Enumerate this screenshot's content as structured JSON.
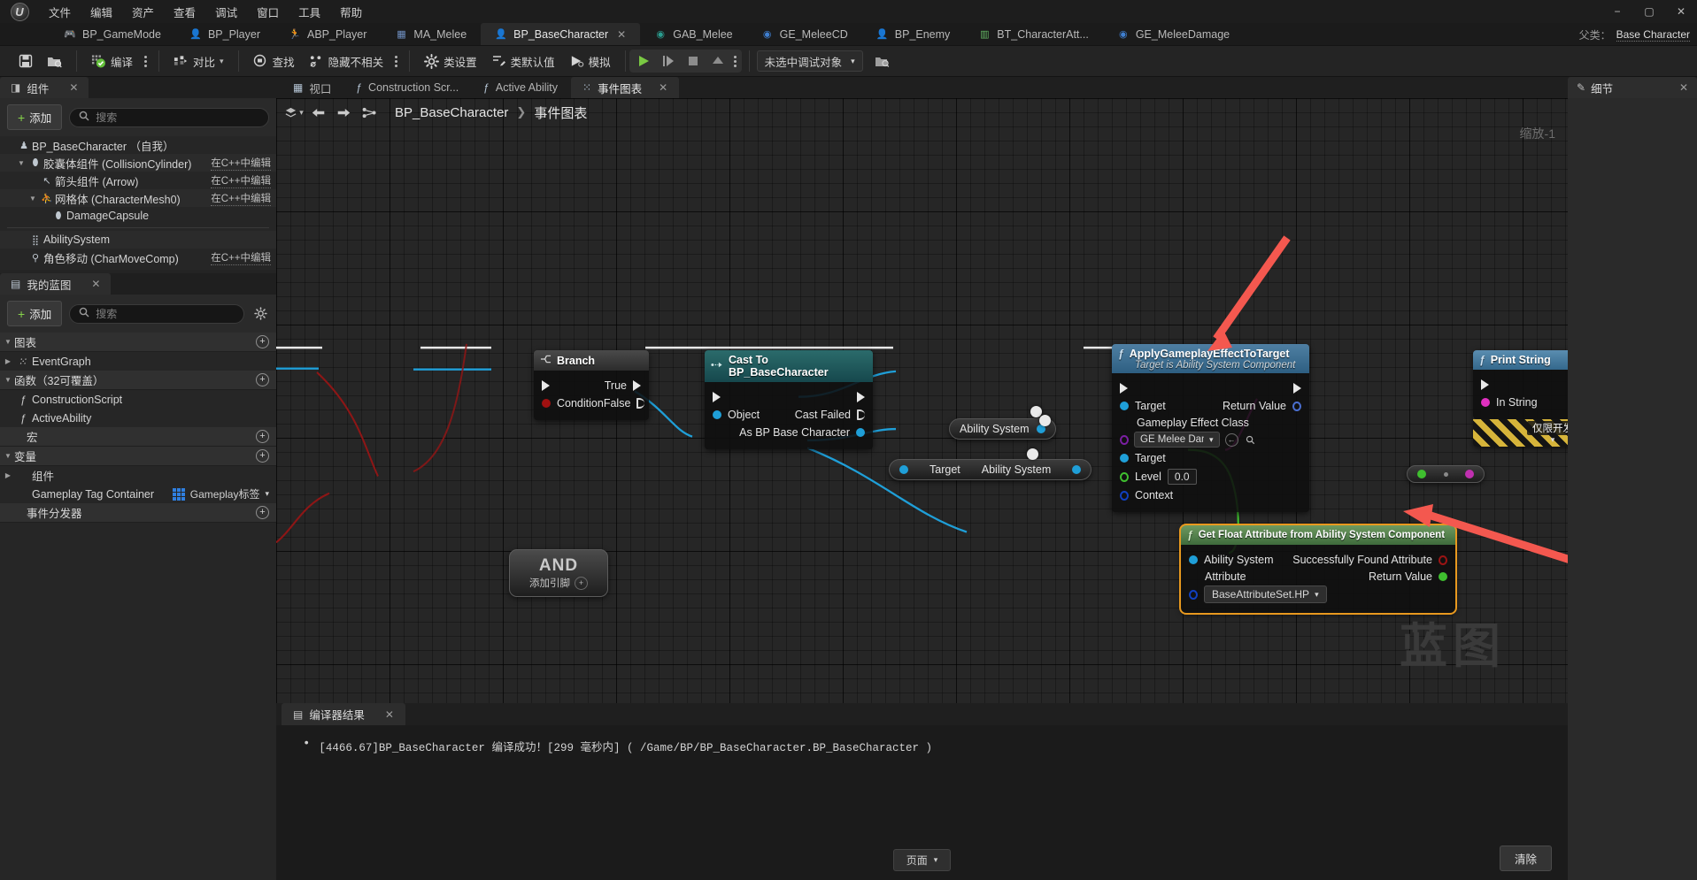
{
  "app": {
    "logo_glyph": "U",
    "menu": [
      "文件",
      "编辑",
      "资产",
      "查看",
      "调试",
      "窗口",
      "工具",
      "帮助"
    ],
    "window_controls": {
      "minimize": "−",
      "maximize": "▢",
      "close": "✕"
    }
  },
  "asset_tabs": [
    {
      "label": "BP_GameMode",
      "icon": "gamemode-icon",
      "glyph": "🎮",
      "color": "#3f7fd0",
      "active": false
    },
    {
      "label": "BP_Player",
      "icon": "character-icon",
      "glyph": "👤",
      "color": "#3f7fd0",
      "active": false
    },
    {
      "label": "ABP_Player",
      "icon": "animbp-icon",
      "glyph": "🏃",
      "color": "#c08a2a",
      "active": false
    },
    {
      "label": "MA_Melee",
      "icon": "montage-icon",
      "glyph": "▦",
      "color": "#6f8fc0",
      "active": false
    },
    {
      "label": "BP_BaseCharacter",
      "icon": "character-icon",
      "glyph": "👤",
      "color": "#3f7fd0",
      "active": true,
      "close": "✕"
    },
    {
      "label": "GAB_Melee",
      "icon": "ability-icon",
      "glyph": "◉",
      "color": "#2a9d8f",
      "active": false
    },
    {
      "label": "GE_MeleeCD",
      "icon": "effect-icon",
      "glyph": "◉",
      "color": "#3f7fd0",
      "active": false
    },
    {
      "label": "BP_Enemy",
      "icon": "character-icon",
      "glyph": "👤",
      "color": "#3f7fd0",
      "active": false
    },
    {
      "label": "BT_CharacterAtt...",
      "icon": "behaviortree-icon",
      "glyph": "▥",
      "color": "#63b463",
      "active": false
    },
    {
      "label": "GE_MeleeDamage",
      "icon": "effect-icon",
      "glyph": "◉",
      "color": "#3f7fd0",
      "active": false
    }
  ],
  "parent_class": {
    "label": "父类：",
    "value": "Base Character"
  },
  "toolbar": {
    "save_icon": "save-icon",
    "browse_icon": "browse-content-icon",
    "compile_label": "编译",
    "compile_icon": "compile-check-icon",
    "diff_label": "对比",
    "diff_icon": "diff-icon",
    "find_label": "查找",
    "find_icon": "find-icon",
    "hide_unrelated_label": "隐藏不相关",
    "hide_unrelated_icon": "hide-unrelated-icon",
    "class_settings_label": "类设置",
    "class_settings_icon": "gear-icon",
    "class_defaults_label": "类默认值",
    "class_defaults_icon": "defaults-icon",
    "simulate_label": "模拟",
    "simulate_icon": "simulate-icon",
    "play_icon": "play-icon",
    "step_icon": "step-icon",
    "stop_icon": "stop-icon",
    "eject_icon": "eject-icon",
    "debug_object": "未选中调试对象",
    "debug_dropdown_icon": "chevron-down-icon"
  },
  "components_panel": {
    "tab_label": "组件",
    "tab_icon": "components-icon",
    "close_icon": "✕",
    "add_label": "添加",
    "search_placeholder": "搜索",
    "search_icon": "search-icon",
    "tree": [
      {
        "indent": 0,
        "arrow": "",
        "icon": "character-icon",
        "label": "BP_BaseCharacter （自我）",
        "cpp": ""
      },
      {
        "indent": 1,
        "arrow": "▼",
        "icon": "capsule-icon",
        "label": "胶囊体组件 (CollisionCylinder)",
        "cpp": "在C++中编辑"
      },
      {
        "indent": 2,
        "arrow": "",
        "icon": "arrow-icon",
        "label": "箭头组件 (Arrow)",
        "cpp": "在C++中编辑"
      },
      {
        "indent": 2,
        "arrow": "▼",
        "icon": "mesh-icon",
        "label": "网格体 (CharacterMesh0)",
        "cpp": "在C++中编辑"
      },
      {
        "indent": 3,
        "arrow": "",
        "icon": "capsule-icon",
        "label": "DamageCapsule",
        "cpp": ""
      },
      {
        "indent": 1,
        "arrow": "",
        "icon": "abilitysystem-icon",
        "label": "AbilitySystem",
        "cpp": "",
        "divider_before": true
      },
      {
        "indent": 1,
        "arrow": "",
        "icon": "movement-icon",
        "label": "角色移动 (CharMoveComp)",
        "cpp": "在C++中编辑"
      }
    ]
  },
  "myblueprint_panel": {
    "tab_label": "我的蓝图",
    "tab_icon": "blueprint-icon",
    "close_icon": "✕",
    "add_label": "添加",
    "search_placeholder": "搜索",
    "search_icon": "search-icon",
    "settings_icon": "gear-icon",
    "sections": [
      {
        "label": "图表",
        "arrow": "▼",
        "plus": "+",
        "items": [
          {
            "icon": "graph-icon",
            "label": "EventGraph",
            "arrow": "▶"
          }
        ]
      },
      {
        "label": "函数（32可覆盖）",
        "arrow": "▼",
        "plus": "+",
        "items": [
          {
            "icon": "function-override-icon",
            "label": "ConstructionScript",
            "arrow": ""
          },
          {
            "icon": "function-icon",
            "label": "ActiveAbility",
            "arrow": ""
          }
        ]
      },
      {
        "label": "宏",
        "arrow": "",
        "plus": "+",
        "items": []
      },
      {
        "label": "变量",
        "arrow": "▼",
        "plus": "+",
        "items": [
          {
            "icon": "",
            "label": "组件",
            "arrow": "▶"
          },
          {
            "icon": "",
            "label": "Gameplay Tag Container",
            "arrow": "",
            "var_type": "Gameplay标签",
            "var_type_icon": "gameplay-tag-icon"
          }
        ]
      },
      {
        "label": "事件分发器",
        "arrow": "",
        "plus": "+",
        "items": []
      }
    ]
  },
  "graph_tabs": [
    {
      "label": "视口",
      "icon": "viewport-icon",
      "active": false
    },
    {
      "label": "Construction Scr...",
      "icon": "function-icon",
      "active": false
    },
    {
      "label": "Active Ability",
      "icon": "function-icon",
      "active": false
    },
    {
      "label": "事件图表",
      "icon": "graph-icon",
      "active": true,
      "close": "✕"
    }
  ],
  "graph": {
    "back_icon": "back-arrow-icon",
    "forward_icon": "forward-arrow-icon",
    "home_icon": "graph-home-icon",
    "layers_icon": "layers-icon",
    "breadcrumb_root": "BP_BaseCharacter",
    "breadcrumb_sep": "❯",
    "breadcrumb_leaf": "事件图表",
    "zoom_label": "缩放-1",
    "watermark": "蓝图"
  },
  "nodes": {
    "branch": {
      "title": "Branch",
      "icon": "branch-icon",
      "exec_in": "",
      "rows": [
        {
          "left_label": "",
          "left_pin": "exec",
          "right_label": "True",
          "right_pin": "exec"
        },
        {
          "left_label": "Condition",
          "left_pin": "bool",
          "right_label": "False",
          "right_pin": "exec-hollow"
        }
      ]
    },
    "cast": {
      "title": "Cast To BP_BaseCharacter",
      "icon": "cast-icon",
      "rows": [
        {
          "left_label": "",
          "left_pin": "exec",
          "right_label": "",
          "right_pin": "exec"
        },
        {
          "left_label": "Object",
          "left_pin": "object",
          "right_label": "Cast Failed",
          "right_pin": "exec-hollow"
        },
        {
          "left_label": "",
          "left_pin": "",
          "right_label": "As BP Base Character",
          "right_pin": "object"
        }
      ]
    },
    "apply_effect": {
      "title": "ApplyGameplayEffectToTarget",
      "subtitle": "Target is Ability System Component",
      "icon": "function-icon",
      "exec_row": {
        "in": "",
        "out": ""
      },
      "rows": [
        {
          "left_label": "Target",
          "left_pin": "object",
          "right_label": "Return Value",
          "right_pin": "struct"
        },
        {
          "left_label": "Gameplay Effect Class",
          "left_pin": "class",
          "combo_value": "GE Melee Damag",
          "combo_icon": "chevron-down-icon",
          "back_icon": "browse-back-icon",
          "search_icon": "search-icon"
        },
        {
          "left_label": "Target",
          "left_pin": "object"
        },
        {
          "left_label": "Level",
          "left_pin": "float",
          "value": "0.0"
        },
        {
          "left_label": "Context",
          "left_pin": "struct-blue"
        }
      ]
    },
    "get_float_attr": {
      "title": "Get Float Attribute from Ability System Component",
      "icon": "function-icon",
      "selected": true,
      "rows": [
        {
          "left_label": "Ability System",
          "left_pin": "object",
          "right_label": "Successfully Found Attribute",
          "right_pin": "bool-hollow"
        },
        {
          "left_label": "Attribute",
          "left_pin": "struct-blue",
          "right_label": "Return Value",
          "right_pin": "float"
        }
      ],
      "combo_value": "BaseAttributeSet.HP",
      "combo_icon": "chevron-down-icon"
    },
    "print_string": {
      "title": "Print String",
      "icon": "function-icon",
      "rows": [
        {
          "left_label": "In String",
          "left_pin": "string"
        }
      ],
      "dev_only": "仅限开发",
      "dev_icon": "chevron-down-icon"
    },
    "and_node": {
      "label": "AND",
      "add_pin": "添加引脚",
      "add_icon": "+"
    },
    "ability_system_pill": {
      "label": "Ability System"
    },
    "target_ability_pill": {
      "left": "Target",
      "right": "Ability System"
    }
  },
  "compiler": {
    "tab_label": "编译器结果",
    "tab_icon": "compiler-icon",
    "close_icon": "✕",
    "messages": [
      "[4466.67]BP_BaseCharacter 编译成功！[299 毫秒内] ( /Game/BP/BP_BaseCharacter.BP_BaseCharacter )"
    ],
    "page_label": "页面",
    "page_icon": "chevron-down-icon",
    "clear_label": "清除"
  },
  "details_panel": {
    "tab_label": "细节",
    "tab_icon": "details-icon",
    "close_icon": "✕"
  },
  "colors": {
    "exec_white": "#e8e8e8",
    "bool_red": "#a01010",
    "object_blue": "#1f9fd8",
    "float_green": "#3fbf2f",
    "struct_blue": "#1040c0",
    "class_purple": "#7b1fa2",
    "string_magenta": "#e030c0",
    "selection_orange": "#e8991f",
    "annotation_red": "#f4584f"
  }
}
